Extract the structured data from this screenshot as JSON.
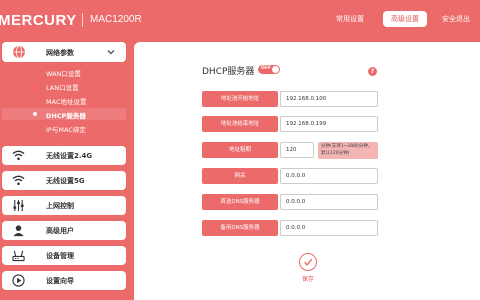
{
  "header": {
    "logo": "MERCURY",
    "model": "MAC1200R",
    "nav": [
      "常用设置",
      "高级设置",
      "安全退出"
    ]
  },
  "sidebar": {
    "group": {
      "label": "网络参数",
      "subitems": [
        "WAN口设置",
        "LAN口设置",
        "MAC地址设置",
        "DHCP服务器",
        "IP与MAC绑定"
      ],
      "active_subitem": "DHCP服务器"
    },
    "items": [
      {
        "label": "无线设置2.4G",
        "icon": "wifi-icon"
      },
      {
        "label": "无线设置5G",
        "icon": "wifi-icon"
      },
      {
        "label": "上网控制",
        "icon": "sliders-icon"
      },
      {
        "label": "高级用户",
        "icon": "user-icon"
      },
      {
        "label": "设备管理",
        "icon": "router-icon"
      },
      {
        "label": "设置向导",
        "icon": "wizard-icon"
      }
    ]
  },
  "main": {
    "title": "DHCP服务器",
    "toggle_label": "OFF",
    "help_icon": "?",
    "fields": [
      {
        "label": "地址池开始地址",
        "value": "192.168.0.100"
      },
      {
        "label": "地址池结束地址",
        "value": "192.168.0.199"
      },
      {
        "label": "地址租期",
        "value": "120"
      },
      {
        "label": "网关",
        "value": "0.0.0.0"
      },
      {
        "label": "首选DNS服务器",
        "value": "0.0.0.0"
      },
      {
        "label": "备用DNS服务器",
        "value": "0.0.0.0"
      }
    ],
    "lease_note": "分钟(支持1~2880分钟，默认120分钟)",
    "save_label": "保存"
  },
  "colors": {
    "accent": "#ec6a6a",
    "panel": "#ffffff",
    "note_bg": "#f4b4b4"
  }
}
